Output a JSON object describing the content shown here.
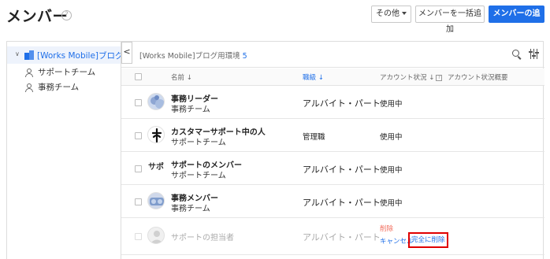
{
  "header": {
    "title": "メンバー",
    "help_glyph": "?",
    "buttons": {
      "other": "その他",
      "bulk_add": "メンバーを一括追加",
      "add": "メンバーの追加"
    }
  },
  "sidebar": {
    "toggle_glyph": "∨",
    "root": "[Works Mobile]ブログ用環",
    "children": [
      "サポートチーム",
      "事務チーム"
    ],
    "collapse_glyph": "<"
  },
  "main": {
    "title": "[Works Mobile]ブログ用環境",
    "count": "5"
  },
  "columns": {
    "name": "名前 ↓",
    "position": "職級 ↓",
    "status": "アカウント状況 ↓",
    "status_help": "?",
    "status_summary": "アカウント状況概要"
  },
  "rows": [
    {
      "name": "事務リーダー",
      "team": "事務チーム",
      "position": "アルバイト・パート",
      "status": "使用中",
      "avatar_text": "",
      "avatar_bg": "#cdd9ee"
    },
    {
      "name": "カスタマーサポート中の人",
      "team": "サポートチーム",
      "position": "管理職",
      "status": "使用中",
      "avatar_text": "✦",
      "avatar_bg": "#ffffff"
    },
    {
      "name": "サポートのメンバー",
      "team": "サポートチーム",
      "position": "アルバイト・パート",
      "status": "使用中",
      "avatar_text": "サポ",
      "avatar_bg": "#ffffff"
    },
    {
      "name": "事務メンバー",
      "team": "事務チーム",
      "position": "アルバイト・パート",
      "status": "使用中",
      "avatar_text": "",
      "avatar_bg": "#cfd8ea"
    },
    {
      "name": "サポートの担当者",
      "team": "",
      "position": "アルバイト・パート",
      "status": "",
      "avatar_text": "",
      "avatar_bg": "#f0f0f0"
    }
  ],
  "pending": {
    "deleted_label": "削除",
    "cancel_label": "キャンセル",
    "permanent_delete_label": "完全に削除"
  },
  "colors": {
    "accent": "#1f6fe8",
    "danger": "#f26b5b",
    "highlight_box": "#e00000"
  }
}
